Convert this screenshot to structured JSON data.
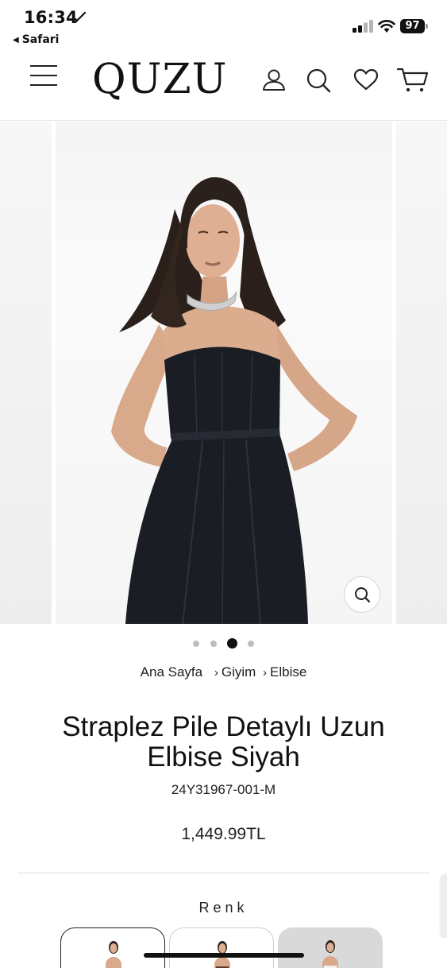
{
  "status_bar": {
    "time": "16:34",
    "back_app": "Safari",
    "battery": "97"
  },
  "header": {
    "logo": "QUZU",
    "icons": [
      "menu-icon",
      "account-icon",
      "search-icon",
      "heart-icon",
      "cart-icon"
    ]
  },
  "gallery": {
    "image_count": 4,
    "active_index": 2
  },
  "breadcrumb": {
    "items": [
      "Ana Sayfa",
      "Giyim",
      "Elbise"
    ],
    "separator": "›"
  },
  "product": {
    "title_line1": "Straplez Pile Detaylı Uzun",
    "title_line2": "Elbise Siyah",
    "sku": "24Y31967-001-M",
    "price": "1,449.99TL"
  },
  "color_section": {
    "label": "Renk",
    "swatch_count": 3,
    "selected_index": 0
  }
}
